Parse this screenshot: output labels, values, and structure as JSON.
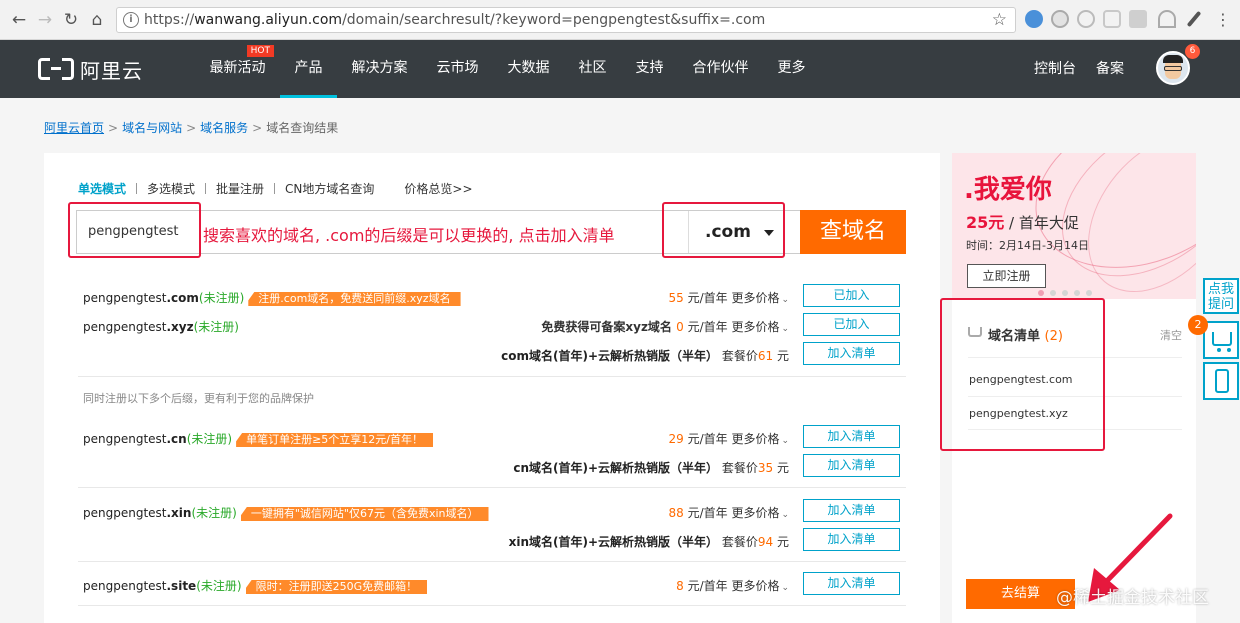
{
  "browser": {
    "url_domain": "wanwang.aliyun.com",
    "url_prefix": "https://",
    "url_path": "/domain/searchresult/?keyword=pengpengtest&suffix=.com"
  },
  "header": {
    "logo_text": "阿里云",
    "nav": [
      "最新活动",
      "产品",
      "解决方案",
      "云市场",
      "大数据",
      "社区",
      "支持",
      "合作伙伴",
      "更多"
    ],
    "hot_badge": "HOT",
    "console": "控制台",
    "beian": "备案",
    "avatar_badge": "6"
  },
  "breadcrumb": [
    "阿里云首页",
    "域名与网站",
    "域名服务",
    "域名查询结果"
  ],
  "tabs": [
    "单选模式",
    "多选模式",
    "批量注册",
    "CN地方域名查询"
  ],
  "price_overview": "价格总览>>",
  "search": {
    "keyword": "pengpengtest",
    "hint": "搜索喜欢的域名, .com的后缀是可以更换的, 点击加入清单",
    "suffix": ".com",
    "button": "查域名"
  },
  "labels": {
    "unregistered": "(未注册)",
    "per_year": " 元/首年 ",
    "more_price": "更多价格",
    "chev": "⌄",
    "pkg_price": " 套餐价",
    "yuan": " 元",
    "add": "加入清单",
    "added": "已加入"
  },
  "results": [
    {
      "name": "pengpengtest",
      "suffix": ".com",
      "tag": "注册.com域名，免费送同前缀.xyz域名",
      "price": "55",
      "button": "已加入"
    },
    {
      "name": "pengpengtest",
      "suffix": ".xyz",
      "free_prefix": "免费获得可备案xyz域名 ",
      "price": "0",
      "button": "已加入"
    },
    {
      "package": "com域名(首年)+云解析热销版（半年）",
      "pkg_price": "61",
      "button": "加入清单"
    }
  ],
  "note": "同时注册以下多个后缀，更有利于您的品牌保护",
  "more_results": [
    {
      "name": "pengpengtest",
      "suffix": ".cn",
      "tag": "单笔订单注册≥5个立享12元/首年！",
      "price": "29",
      "package": "cn域名(首年)+云解析热销版（半年）",
      "pkg_price": "35"
    },
    {
      "name": "pengpengtest",
      "suffix": ".xin",
      "tag": "一键拥有\"诚信网站\"仅67元（含免费xin域名）",
      "price": "88",
      "package": "xin域名(首年)+云解析热销版（半年）",
      "pkg_price": "94"
    },
    {
      "name": "pengpengtest",
      "suffix": ".site",
      "tag": "限时：注册即送250G免费邮箱！",
      "price": "8"
    }
  ],
  "banner": {
    "title": ".我爱你",
    "offer_price": "25元",
    "offer_text": " / 首年大促",
    "date": "时间：2月14日-3月14日",
    "button": "立即注册"
  },
  "cart": {
    "title": "域名清单",
    "count": "(2)",
    "clear": "清空",
    "items": [
      "pengpengtest.com",
      "pengpengtest.xyz"
    ],
    "checkout": "去结算"
  },
  "float": {
    "ask": "点我提问",
    "badge": "2"
  },
  "watermark": "@稀土掘金技术社区",
  "colors": {
    "header_bg": "#373d41",
    "accent": "#00a2ca",
    "orange": "#ff6a00",
    "annotation_red": "#e6183d",
    "green": "#2aa92a"
  }
}
